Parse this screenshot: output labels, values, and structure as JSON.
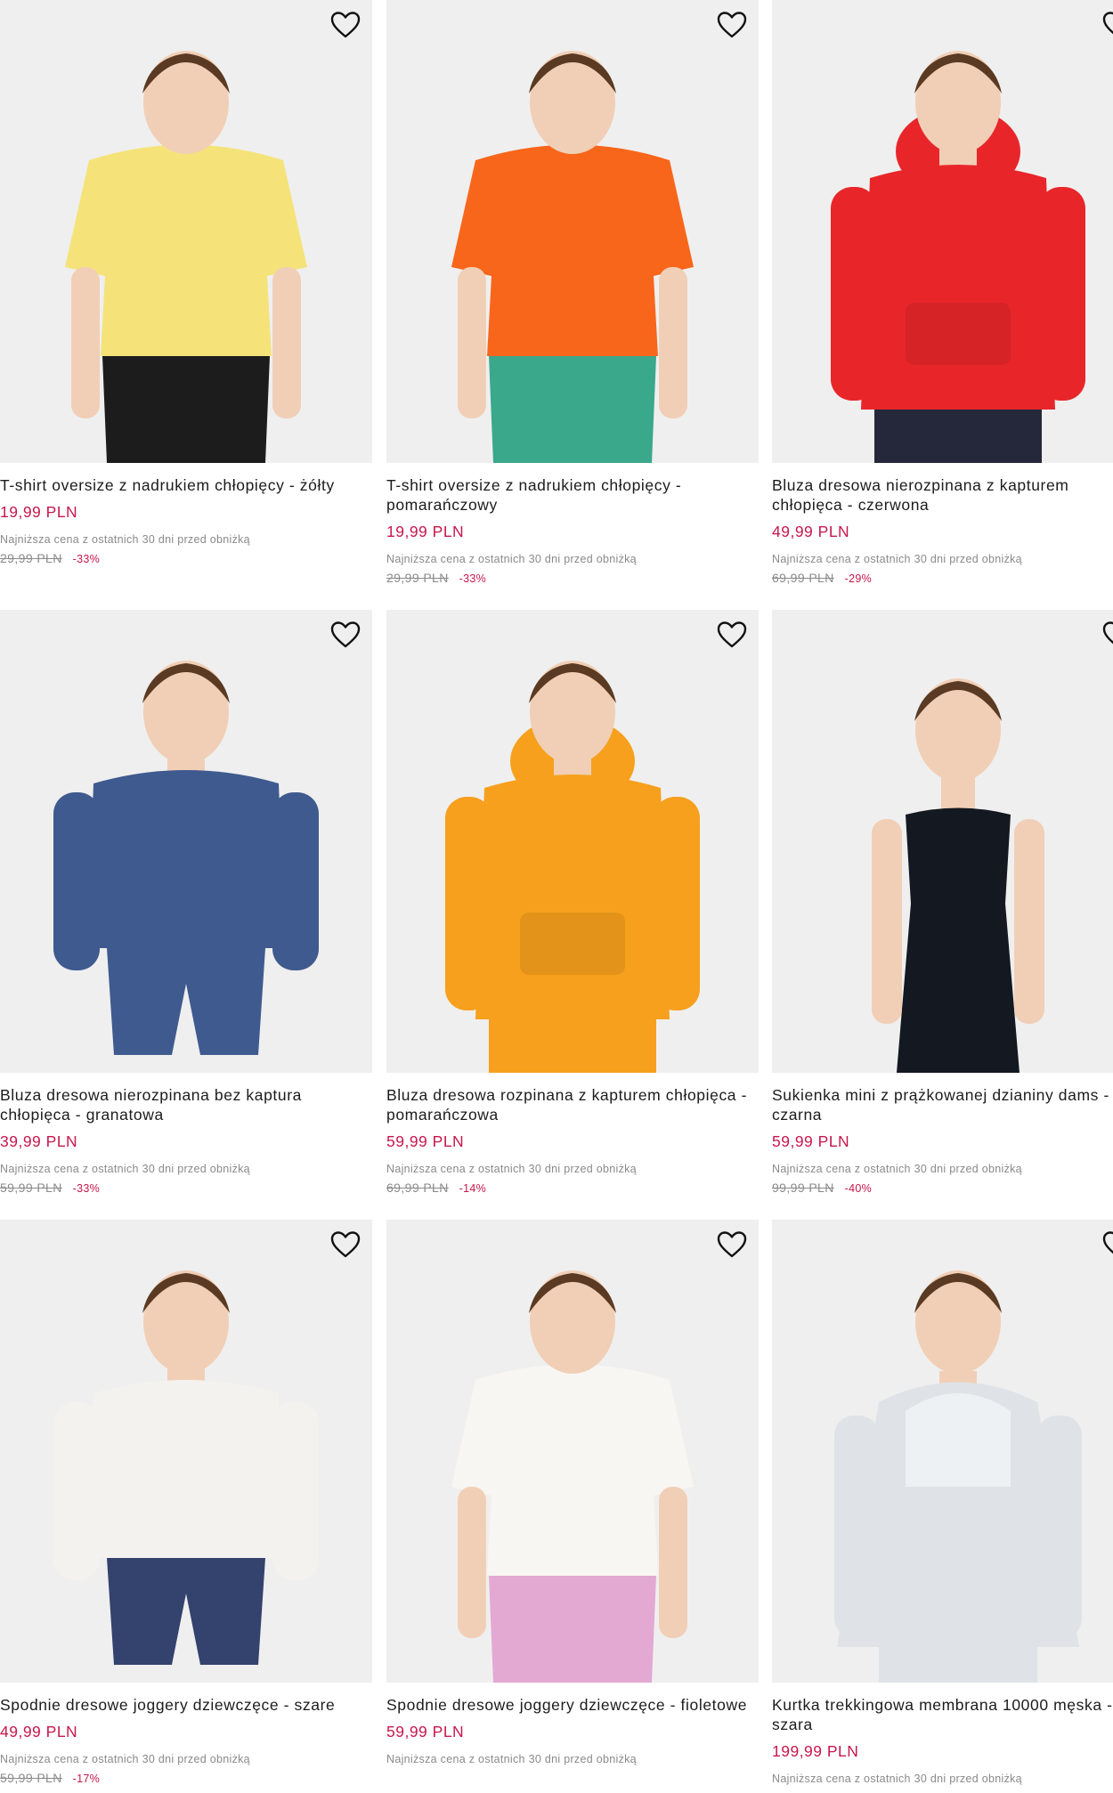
{
  "colors": {
    "accent_price": "#c8174d",
    "muted": "#8a8a8a",
    "image_bg": "#efefef"
  },
  "icons": {
    "wishlist": "heart-outline-icon"
  },
  "products": [
    {
      "title": "T-shirt oversize z nadrukiem chłopięcy - żółty",
      "price": "19,99 PLN",
      "lowest_note": "Najniższa cena z ostatnich 30 dni przed obniżką",
      "old_price": "29,99 PLN",
      "discount": "-33%",
      "garment_color": "#f5e37a",
      "bottom_color": "#1c1c1c",
      "style": "tee"
    },
    {
      "title": "T-shirt oversize z nadrukiem chłopięcy - pomarańczowy",
      "price": "19,99 PLN",
      "lowest_note": "Najniższa cena z ostatnich 30 dni przed obniżką",
      "old_price": "29,99 PLN",
      "discount": "-33%",
      "garment_color": "#f8661b",
      "bottom_color": "#3aa88a",
      "style": "tee"
    },
    {
      "title": "Bluza dresowa nierozpinana z kapturem chłopięca - czerwona",
      "price": "49,99 PLN",
      "lowest_note": "Najniższa cena z ostatnich 30 dni przed obniżką",
      "old_price": "69,99 PLN",
      "discount": "-29%",
      "garment_color": "#e8262a",
      "bottom_color": "#24283a",
      "style": "hoodie"
    },
    {
      "title": "Bluza dresowa nierozpinana bez kaptura chłopięca - granatowa",
      "price": "39,99 PLN",
      "lowest_note": "Najniższa cena z ostatnich 30 dni przed obniżką",
      "old_price": "59,99 PLN",
      "discount": "-33%",
      "garment_color": "#3f5a8f",
      "bottom_color": "#3f5a8f",
      "style": "sweat"
    },
    {
      "title": "Bluza dresowa rozpinana z kapturem chłopięca - pomarańczowa",
      "price": "59,99 PLN",
      "lowest_note": "Najniższa cena z ostatnich 30 dni przed obniżką",
      "old_price": "69,99 PLN",
      "discount": "-14%",
      "garment_color": "#f7a01d",
      "bottom_color": "#f7a01d",
      "style": "hoodie"
    },
    {
      "title": "Sukienka mini z prążkowanej dzianiny dams - czarna",
      "price": "59,99 PLN",
      "lowest_note": "Najniższa cena z ostatnich 30 dni przed obniżką",
      "old_price": "99,99 PLN",
      "discount": "-40%",
      "garment_color": "#141820",
      "bottom_color": "#141820",
      "style": "dress"
    },
    {
      "title": "Spodnie dresowe joggery dziewczęce - szare",
      "price": "49,99 PLN",
      "lowest_note": "Najniższa cena z ostatnich 30 dni przed obniżką",
      "old_price": "59,99 PLN",
      "discount": "-17%",
      "garment_color": "#f4f2ee",
      "bottom_color": "#34426e",
      "style": "sweat"
    },
    {
      "title": "Spodnie dresowe joggery dziewczęce - fioletowe",
      "price": "59,99 PLN",
      "lowest_note": "Najniższa cena z ostatnich 30 dni przed obniżką",
      "old_price": "",
      "discount": "",
      "garment_color": "#f8f6f2",
      "bottom_color": "#e3a9d3",
      "style": "tee"
    },
    {
      "title": "Kurtka trekkingowa membrana 10000 męska - szara",
      "price": "199,99 PLN",
      "lowest_note": "Najniższa cena z ostatnich 30 dni przed obniżką",
      "old_price": "",
      "discount": "",
      "garment_color": "#dfe3e7",
      "bottom_color": "#dfe3e7",
      "style": "jacket"
    }
  ]
}
